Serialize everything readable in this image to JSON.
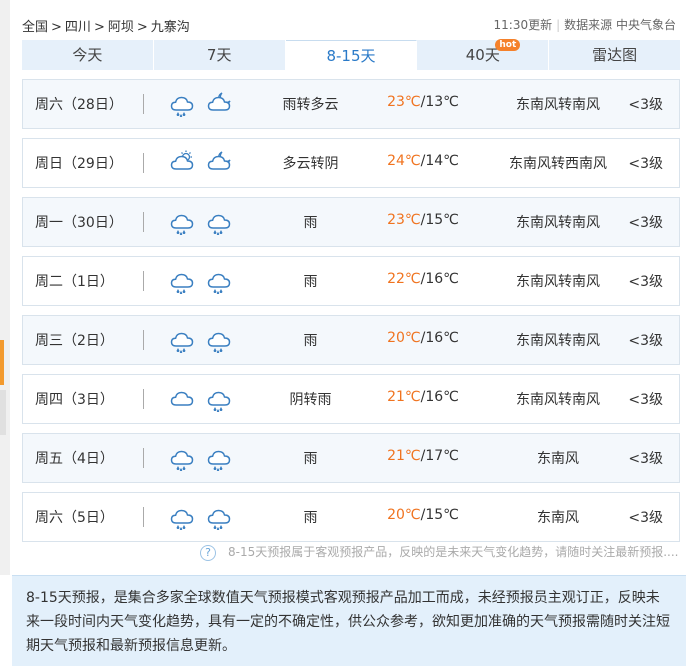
{
  "breadcrumb": {
    "items": [
      "全国",
      "四川",
      "阿坝",
      "九寨沟"
    ],
    "sep": ">"
  },
  "header_meta": {
    "updated": "11:30更新",
    "source": "数据来源 中央气象台"
  },
  "tabs": [
    {
      "label": "今天",
      "active": false
    },
    {
      "label": "7天",
      "active": false
    },
    {
      "label": "8-15天",
      "active": true
    },
    {
      "label": "40天",
      "active": false,
      "badge": "hot"
    },
    {
      "label": "雷达图",
      "active": false
    }
  ],
  "forecast": [
    {
      "day": "周六（28日）",
      "icons": [
        "rain-cloud-icon",
        "moon-cloud-icon"
      ],
      "desc": "雨转多云",
      "high": "23℃",
      "low": "/13℃",
      "wind": "东南风转南风",
      "level": "<3级"
    },
    {
      "day": "周日（29日）",
      "icons": [
        "sun-cloud-icon",
        "moon-cloud-icon"
      ],
      "desc": "多云转阴",
      "high": "24℃",
      "low": "/14℃",
      "wind": "东南风转西南风",
      "level": "<3级"
    },
    {
      "day": "周一（30日）",
      "icons": [
        "rain-cloud-icon",
        "rain-cloud-icon"
      ],
      "desc": "雨",
      "high": "23℃",
      "low": "/15℃",
      "wind": "东南风转南风",
      "level": "<3级"
    },
    {
      "day": "周二（1日）",
      "icons": [
        "rain-cloud-icon",
        "rain-cloud-icon"
      ],
      "desc": "雨",
      "high": "22℃",
      "low": "/16℃",
      "wind": "东南风转南风",
      "level": "<3级"
    },
    {
      "day": "周三（2日）",
      "icons": [
        "rain-cloud-icon",
        "rain-cloud-icon"
      ],
      "desc": "雨",
      "high": "20℃",
      "low": "/16℃",
      "wind": "东南风转南风",
      "level": "<3级"
    },
    {
      "day": "周四（3日）",
      "icons": [
        "cloud-icon",
        "rain-cloud-icon"
      ],
      "desc": "阴转雨",
      "high": "21℃",
      "low": "/16℃",
      "wind": "东南风转南风",
      "level": "<3级"
    },
    {
      "day": "周五（4日）",
      "icons": [
        "rain-cloud-icon",
        "rain-cloud-icon"
      ],
      "desc": "雨",
      "high": "21℃",
      "low": "/17℃",
      "wind": "东南风",
      "level": "<3级"
    },
    {
      "day": "周六（5日）",
      "icons": [
        "rain-cloud-icon",
        "rain-cloud-icon"
      ],
      "desc": "雨",
      "high": "20℃",
      "low": "/15℃",
      "wind": "东南风",
      "level": "<3级"
    }
  ],
  "note": "8-15天预报属于客观预报产品，反映的是未来天气变化趋势，请随时关注最新预报....",
  "info": "8-15天预报，是集合多家全球数值天气预报模式客观预报产品加工而成，未经预报员主观订正，反映未来一段时间内天气变化趋势，具有一定的不确定性，供公众参考，欲知更加准确的天气预报需随时关注短期天气预报和最新预报信息更新。",
  "colors": {
    "accent": "#2a7ac8",
    "high_temp": "#f0731f",
    "icon": "#3a7fc1",
    "tab_bg": "#e6f0fa",
    "info_bg": "#e3f0fb"
  }
}
